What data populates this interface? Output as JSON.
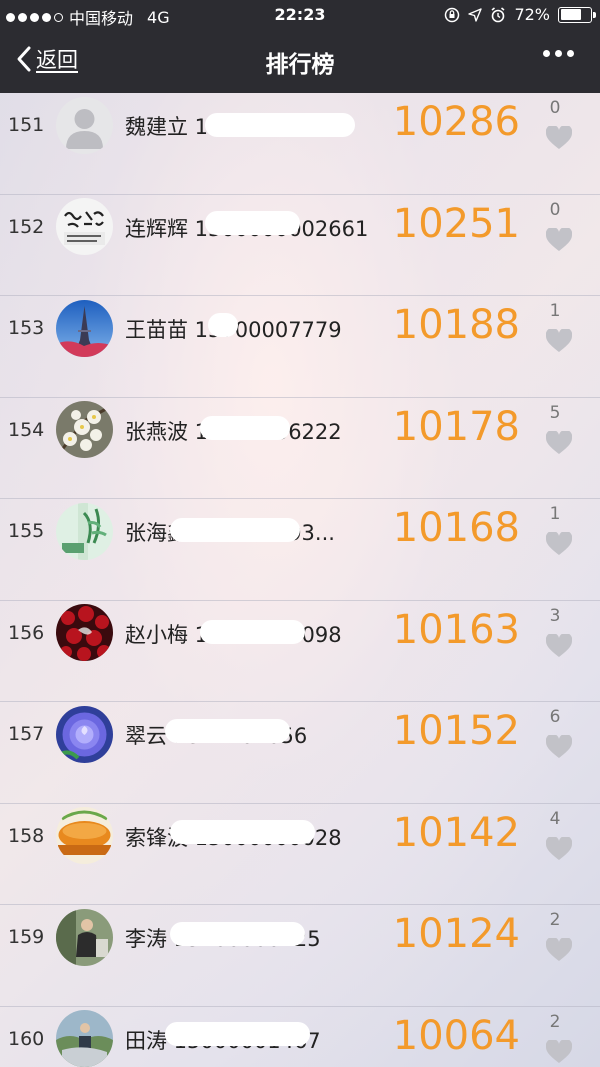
{
  "status_bar": {
    "carrier": "中国移动",
    "network": "4G",
    "time": "22:23",
    "battery": "72%",
    "battery_level": 0.72
  },
  "nav": {
    "back_label": "返回",
    "title": "排行榜",
    "more_icon": "more-dots-icon"
  },
  "colors": {
    "score": "#f39a2b",
    "navbar": "#2c2c31"
  },
  "rows": [
    {
      "rank": "151",
      "name": "魏建立 15031000730",
      "score": "10286",
      "likes": "0",
      "avatar": "default-user"
    },
    {
      "rank": "152",
      "name": "连辉辉 1500000002661",
      "score": "10251",
      "likes": "0",
      "avatar": "calligraphy-text"
    },
    {
      "rank": "153",
      "name": "王苗苗 15700007779",
      "score": "10188",
      "likes": "1",
      "avatar": "eiffel-tower"
    },
    {
      "rank": "154",
      "name": "张燕波 10011406222",
      "score": "10178",
      "likes": "5",
      "avatar": "white-blossoms"
    },
    {
      "rank": "155",
      "name": "张海鑫 121000693...",
      "score": "10168",
      "likes": "1",
      "avatar": "green-bamboo"
    },
    {
      "rank": "156",
      "name": "赵小梅 15010000098",
      "score": "10163",
      "likes": "3",
      "avatar": "red-flowers"
    },
    {
      "rank": "157",
      "name": "翠云 1317401056",
      "score": "10152",
      "likes": "6",
      "avatar": "blue-rose"
    },
    {
      "rank": "158",
      "name": "索锋波 15000000028",
      "score": "10142",
      "likes": "4",
      "avatar": "bread-food"
    },
    {
      "rank": "159",
      "name": "李涛 15700000725",
      "score": "10124",
      "likes": "2",
      "avatar": "person-photo"
    },
    {
      "rank": "160",
      "name": "田涛 15000001467",
      "score": "10064",
      "likes": "2",
      "avatar": "person-landscape"
    }
  ]
}
